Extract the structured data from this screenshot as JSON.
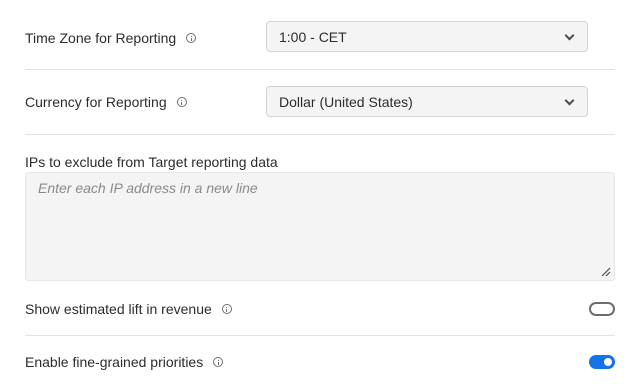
{
  "timezone": {
    "label": "Time Zone for Reporting",
    "value": "1:00 - CET"
  },
  "currency": {
    "label": "Currency for Reporting",
    "value": "Dollar (United States)"
  },
  "ip_exclude": {
    "label": "IPs to exclude from Target reporting data",
    "placeholder": "Enter each IP address in a new line"
  },
  "lift_revenue": {
    "label": "Show estimated lift in revenue",
    "enabled": false
  },
  "fine_grained": {
    "label": "Enable fine-grained priorities",
    "enabled": true
  },
  "colors": {
    "accent": "#1473e6",
    "field_bg": "#f4f4f4",
    "divider": "#e1e1e1"
  }
}
